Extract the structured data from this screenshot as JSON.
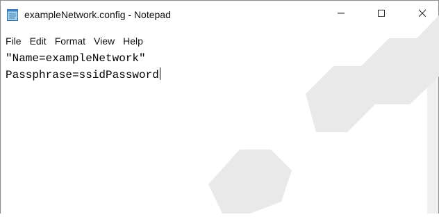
{
  "window": {
    "title": "exampleNetwork.config - Notepad",
    "app_icon": "notepad-icon",
    "controls": {
      "minimize_icon": "minimize-icon",
      "maximize_icon": "maximize-icon",
      "close_icon": "close-icon"
    }
  },
  "menu": {
    "items": [
      "File",
      "Edit",
      "Format",
      "View",
      "Help"
    ]
  },
  "editor": {
    "lines": [
      "\"Name=exampleNetwork\"",
      "Passphrase=ssidPassword"
    ]
  },
  "colors": {
    "text": "#000000",
    "titlebar": "#ffffff",
    "scrollbar_track": "#f0f0f0",
    "window_border": "#8c8c8c"
  }
}
